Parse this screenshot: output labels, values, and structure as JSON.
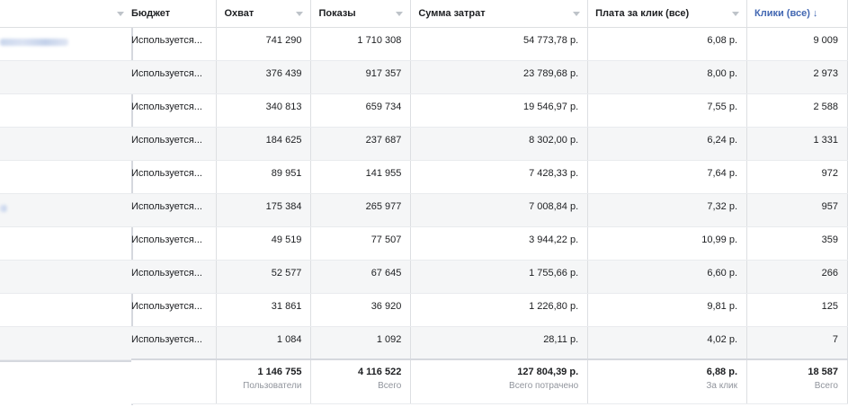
{
  "columns": {
    "budget": "Бюджет",
    "reach": "Охват",
    "impressions": "Показы",
    "spend": "Сумма затрат",
    "cpc": "Плата за клик (все)",
    "clicks": "Клики (все)",
    "clicks_sort_arrow": "↓"
  },
  "rows": [
    {
      "budget": "Используется...",
      "reach": "741 290",
      "impressions": "1 710 308",
      "spend": "54 773,78 р.",
      "cpc": "6,08 р.",
      "clicks": "9 009"
    },
    {
      "budget": "Используется...",
      "reach": "376 439",
      "impressions": "917 357",
      "spend": "23 789,68 р.",
      "cpc": "8,00 р.",
      "clicks": "2 973"
    },
    {
      "budget": "Используется...",
      "reach": "340 813",
      "impressions": "659 734",
      "spend": "19 546,97 р.",
      "cpc": "7,55 р.",
      "clicks": "2 588"
    },
    {
      "budget": "Используется...",
      "reach": "184 625",
      "impressions": "237 687",
      "spend": "8 302,00 р.",
      "cpc": "6,24 р.",
      "clicks": "1 331"
    },
    {
      "budget": "Используется...",
      "reach": "89 951",
      "impressions": "141 955",
      "spend": "7 428,33 р.",
      "cpc": "7,64 р.",
      "clicks": "972"
    },
    {
      "budget": "Используется...",
      "reach": "175 384",
      "impressions": "265 977",
      "spend": "7 008,84 р.",
      "cpc": "7,32 р.",
      "clicks": "957"
    },
    {
      "budget": "Используется...",
      "reach": "49 519",
      "impressions": "77 507",
      "spend": "3 944,22 р.",
      "cpc": "10,99 р.",
      "clicks": "359"
    },
    {
      "budget": "Используется...",
      "reach": "52 577",
      "impressions": "67 645",
      "spend": "1 755,66 р.",
      "cpc": "6,60 р.",
      "clicks": "266"
    },
    {
      "budget": "Используется...",
      "reach": "31 861",
      "impressions": "36 920",
      "spend": "1 226,80 р.",
      "cpc": "9,81 р.",
      "clicks": "125"
    },
    {
      "budget": "Используется...",
      "reach": "1 084",
      "impressions": "1 092",
      "spend": "28,11 р.",
      "cpc": "4,02 р.",
      "clicks": "7"
    }
  ],
  "totals": {
    "reach": {
      "value": "1 146 755",
      "label": "Пользователи"
    },
    "impressions": {
      "value": "4 116 522",
      "label": "Всего"
    },
    "spend": {
      "value": "127 804,39 р.",
      "label": "Всего потрачено"
    },
    "cpc": {
      "value": "6,88 р.",
      "label": "За клик"
    },
    "clicks": {
      "value": "18 587",
      "label": "Всего"
    }
  }
}
